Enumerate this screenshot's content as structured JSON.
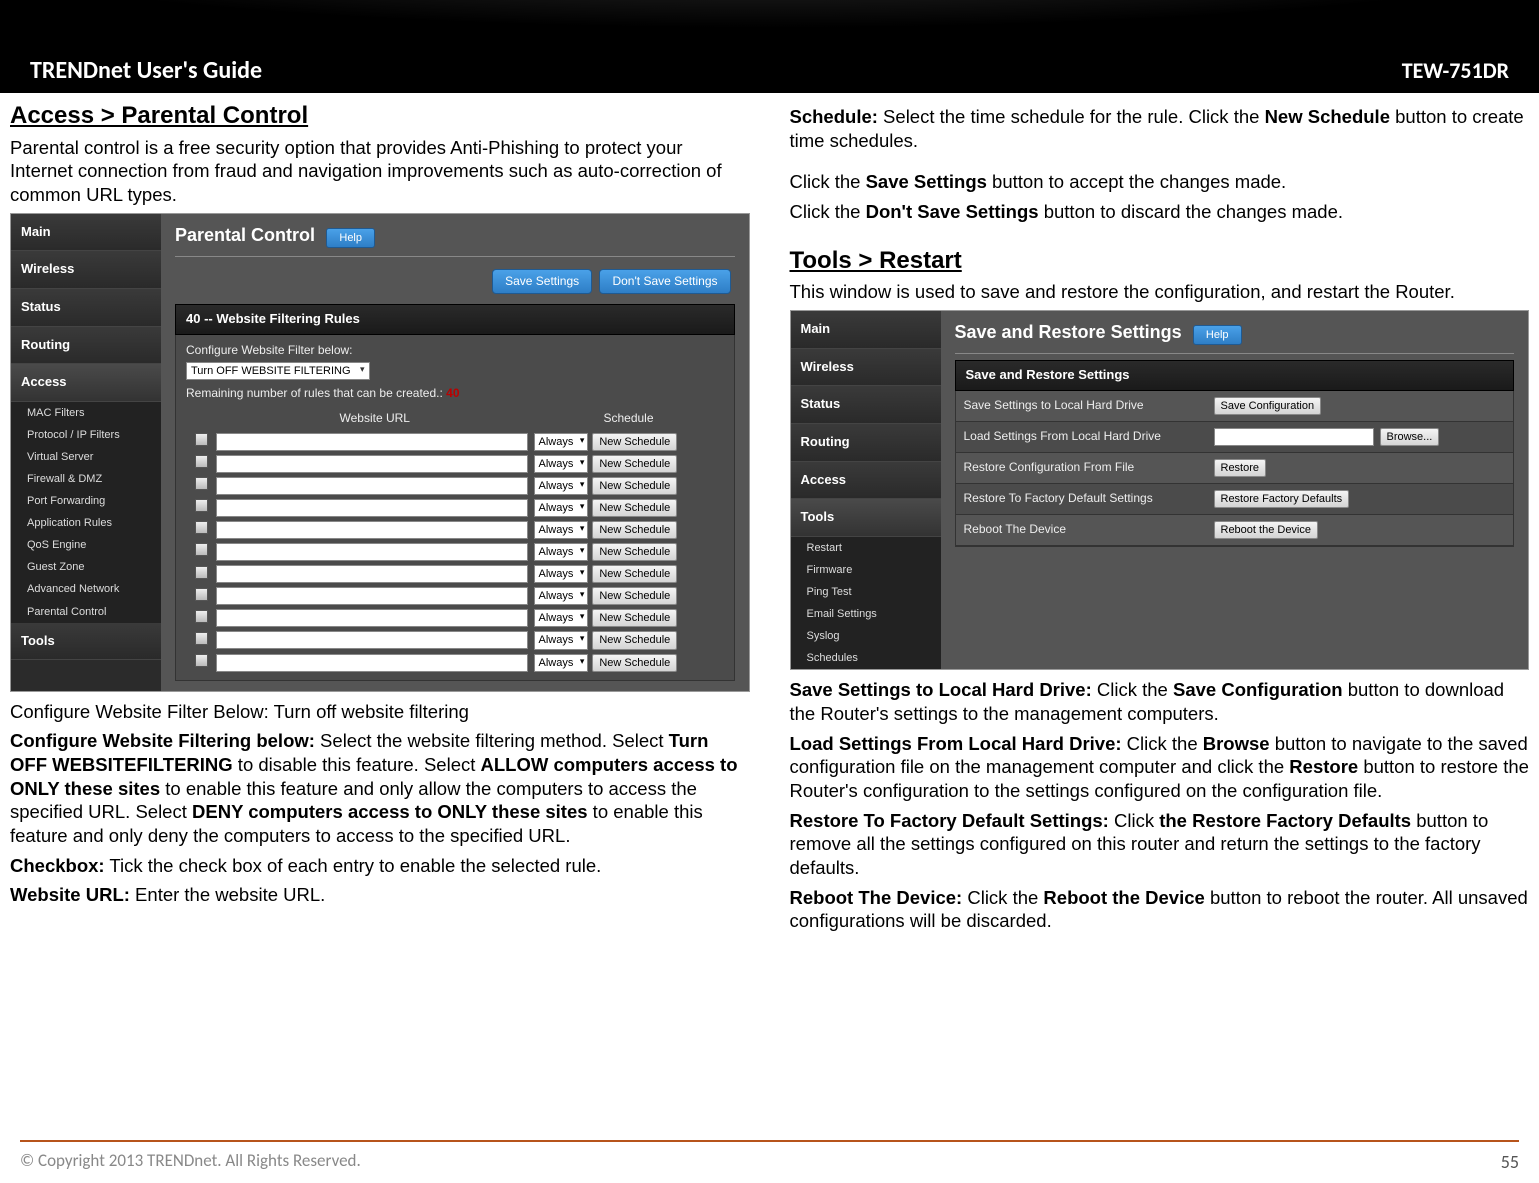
{
  "title_bar": {
    "left": "TRENDnet User's Guide",
    "right": "TEW-751DR"
  },
  "col1": {
    "heading": "Access > Parental Control",
    "intro": "Parental control is a free security option that provides Anti-Phishing to protect your Internet connection from fraud and navigation improvements such as auto-correction of common URL types.",
    "shot": {
      "nav": [
        "Main",
        "Wireless",
        "Status",
        "Routing",
        "Access"
      ],
      "subnav": [
        "MAC Filters",
        "Protocol / IP Filters",
        "Virtual Server",
        "Firewall & DMZ",
        "Port Forwarding",
        "Application Rules",
        "QoS Engine",
        "Guest Zone",
        "Advanced Network",
        "Parental Control"
      ],
      "nav_after": [
        "Tools"
      ],
      "page_title": "Parental Control",
      "help": "Help",
      "save": "Save Settings",
      "dont_save": "Don't Save Settings",
      "section_bar": "40 -- Website Filtering Rules",
      "cfg_label": "Configure Website Filter below:",
      "select_val": "Turn OFF WEBSITE FILTERING",
      "remain_label": "Remaining number of rules that can be created.:",
      "remain_val": "40",
      "th_url": "Website URL",
      "th_sched": "Schedule",
      "row_sel": "Always",
      "row_btn": "New Schedule",
      "row_count": 11
    },
    "p_cfg_below": "Configure Website Filter Below: Turn off website filtering",
    "p_cfg": {
      "lead": "Configure Website Filtering below:",
      "t1": " Select the website filtering method. Select ",
      "b1": "Turn OFF WEBSITEFILTERING",
      "t2": " to disable this feature. Select ",
      "b2": "ALLOW computers access to ONLY these sites",
      "t3": " to enable this feature and only allow the computers to access the specified URL. Select ",
      "b3": "DENY computers access to ONLY these sites",
      "t4": " to enable this feature and only deny the computers to access to the specified URL."
    },
    "p_checkbox": {
      "lead": "Checkbox:",
      "text": " Tick the check box of each entry to enable the selected rule."
    },
    "p_url": {
      "lead": "Website URL:",
      "text": " Enter the website URL."
    }
  },
  "col2": {
    "p_sched": {
      "lead": "Schedule:",
      "t1": " Select the time schedule for the rule. Click the ",
      "b1": "New Schedule",
      "t2": " button to create time schedules."
    },
    "p_save": {
      "t1": "Click the ",
      "b1": "Save Settings",
      "t2": " button to accept the changes made."
    },
    "p_dont": {
      "t1": "Click the ",
      "b1": "Don't Save Settings",
      "t2": " button to discard the changes made."
    },
    "heading": "Tools > Restart",
    "intro": "This window is used to save and restore the configuration, and restart the Router.",
    "shot": {
      "nav": [
        "Main",
        "Wireless",
        "Status",
        "Routing",
        "Access",
        "Tools"
      ],
      "subnav": [
        "Restart",
        "Firmware",
        "Ping Test",
        "Email Settings",
        "Syslog",
        "Schedules"
      ],
      "page_title": "Save and Restore Settings",
      "help": "Help",
      "section_bar": "Save and Restore Settings",
      "rows": [
        {
          "lbl": "Save Settings to Local Hard Drive",
          "btn": "Save Configuration"
        },
        {
          "lbl": "Load Settings From Local Hard Drive",
          "box": true,
          "btn": "Browse..."
        },
        {
          "lbl": "Restore Configuration From File",
          "btn": "Restore"
        },
        {
          "lbl": "Restore To Factory Default Settings",
          "btn": "Restore Factory Defaults"
        },
        {
          "lbl": "Reboot The Device",
          "btn": "Reboot the Device"
        }
      ]
    },
    "p_savehd": {
      "lead": "Save Settings to Local Hard Drive:",
      "t1": " Click the ",
      "b1": "Save Configuration",
      "t2": " button to download the Router's settings to the management computers."
    },
    "p_loadhd": {
      "lead": "Load Settings From Local Hard Drive:",
      "t1": " Click the ",
      "b1": "Browse",
      "t2": " button to navigate to the saved configuration file on the management computer and click the ",
      "b2": "Restore",
      "t3": " button to restore the Router's configuration to the settings configured on the configuration file."
    },
    "p_factory": {
      "lead": "Restore To Factory Default Settings:",
      "t1": " Click ",
      "b1": "the Restore Factory Defaults",
      "t2": " button to remove all the settings configured on this router and return the settings to the factory defaults."
    },
    "p_reboot": {
      "lead": "Reboot The Device:",
      "t1": " Click the ",
      "b1": "Reboot the Device",
      "t2": " button to reboot the router. All unsaved configurations will be discarded."
    }
  },
  "footer": {
    "copyright": "© Copyright 2013 TRENDnet. All Rights Reserved.",
    "page": "55"
  }
}
